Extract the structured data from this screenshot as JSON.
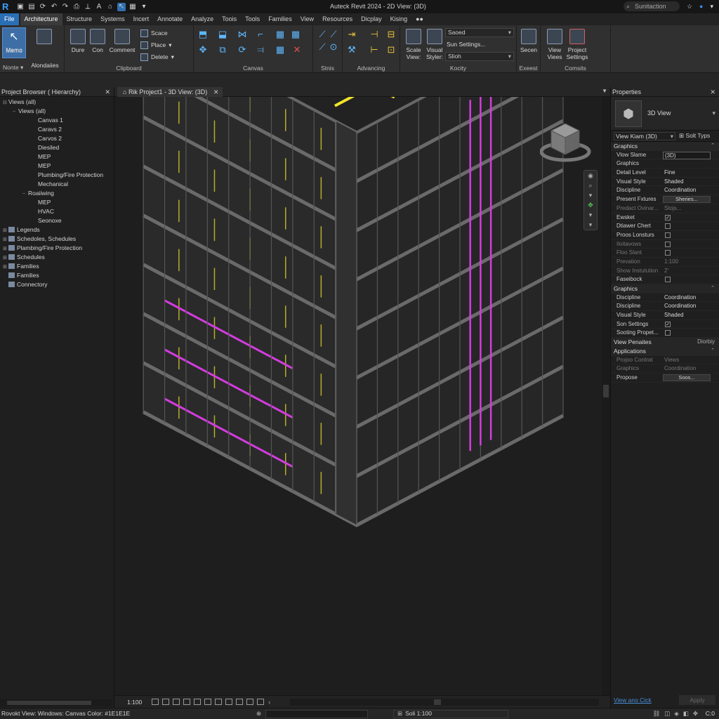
{
  "window": {
    "title": "Auteck Revit 2024 - 2D View: (3D)",
    "search_placeholder": "Sunitaction",
    "logo": "R"
  },
  "tabs": [
    "File",
    "Architecture",
    "Structure",
    "Systems",
    "Incert",
    "Annotate",
    "Analyze",
    "Toois",
    "Tools",
    "Families",
    "View",
    "Resources",
    "Dicplay",
    "Kising",
    "●●"
  ],
  "ribbon": {
    "modify": {
      "big1": "Memo",
      "big2": "Alondaiies",
      "label": "Nonte"
    },
    "clipboard": {
      "b1": "Dure",
      "b2": "Con",
      "b3": "Comment",
      "s1": "Scace",
      "s2": "Place",
      "s3": "Delete",
      "label": "Clipboard"
    },
    "canvas": {
      "label": "Canvas"
    },
    "stnis": {
      "label": "Stnis"
    },
    "advancing": {
      "label": "Advancing"
    },
    "kocity": {
      "b1": "Scale View:",
      "b2": "Visual Styler:",
      "dd1": "Saoed",
      "dd2": "Sun Settings...",
      "dd3": "Slioh",
      "label": "Kocity"
    },
    "exeest": {
      "b1": "Secen",
      "label": "Exeest"
    },
    "comsits": {
      "b1": "View Viees",
      "b2": "Project Settings",
      "label": "Comsits"
    }
  },
  "browser": {
    "title": "Project Browser ( Hierarchy)",
    "items": [
      {
        "label": "Views (all)",
        "level": 0,
        "tog": "⊟"
      },
      {
        "label": "Views (all)",
        "level": 1,
        "tog": "−"
      },
      {
        "label": "Canvas 1",
        "level": 3,
        "tog": ""
      },
      {
        "label": "Caravs 2",
        "level": 3,
        "tog": ""
      },
      {
        "label": "Carvos 2",
        "level": 3,
        "tog": ""
      },
      {
        "label": "Diesiled",
        "level": 3,
        "tog": ""
      },
      {
        "label": "MEP",
        "level": 3,
        "tog": ""
      },
      {
        "label": "MEP",
        "level": 3,
        "tog": ""
      },
      {
        "label": "Plumbing/Fire Protection",
        "level": 3,
        "tog": ""
      },
      {
        "label": "Mechanical",
        "level": 3,
        "tog": ""
      },
      {
        "label": "Roaiiwing",
        "level": 2,
        "tog": "−"
      },
      {
        "label": "MEP",
        "level": 3,
        "tog": ""
      },
      {
        "label": "HVAC",
        "level": 3,
        "tog": ""
      },
      {
        "label": "Seonoxe",
        "level": 3,
        "tog": ""
      },
      {
        "label": "Legends",
        "level": 0,
        "tog": "⊞",
        "icon": true
      },
      {
        "label": "Schedoles, Schedules",
        "level": 0,
        "tog": "⊞",
        "icon": true
      },
      {
        "label": "Plambing/Fire Protection",
        "level": 0,
        "tog": "⊞",
        "icon": true
      },
      {
        "label": "Schedules",
        "level": 0,
        "tog": "⊞",
        "icon": true
      },
      {
        "label": "Families",
        "level": 0,
        "tog": "⊞",
        "icon": true
      },
      {
        "label": "Families",
        "level": 0,
        "tog": "",
        "icon": true
      },
      {
        "label": "Connectory",
        "level": 0,
        "tog": "",
        "icon": true
      }
    ]
  },
  "view": {
    "tab_label": "Rik Project1 - 3D View: (3D)",
    "scale": "1:100",
    "colors": {
      "yellow": "#f2e52a",
      "cyan": "#27d3e8",
      "magenta": "#d43ce0",
      "structure": "#3c3c3c"
    }
  },
  "properties": {
    "title": "Properties",
    "type_name": "3D View",
    "view_name_field": "View Kiam (3D)",
    "edit_type": "Solt Typs",
    "groups": [
      {
        "header": "Graphics",
        "rows": [
          {
            "k": "Vlow Slame",
            "v": "(3D)",
            "kind": "input"
          },
          {
            "k": "Graphics",
            "v": "",
            "kind": "text"
          },
          {
            "k": "Detail Level",
            "v": "Fine",
            "kind": "text"
          },
          {
            "k": "Visual Style",
            "v": "Shaded",
            "kind": "text"
          },
          {
            "k": "Discipline",
            "v": "Coordination",
            "kind": "text"
          },
          {
            "k": "Present Fxtures",
            "v": "Sheries...",
            "kind": "button"
          },
          {
            "k": "Predact Ovinar...",
            "v": "Stojs...",
            "kind": "dimtext"
          },
          {
            "k": "Ewsket",
            "v": "✓",
            "kind": "check"
          },
          {
            "k": "Dtiawer Chert",
            "v": "",
            "kind": "check"
          },
          {
            "k": "Proos Lonsturs",
            "v": "",
            "kind": "check"
          },
          {
            "k": "Iloitavows",
            "v": "",
            "kind": "dimcheck"
          },
          {
            "k": "Floo Slant",
            "v": "",
            "kind": "dimcheck"
          },
          {
            "k": "Prevation",
            "v": "1:100",
            "kind": "dimtext"
          },
          {
            "k": "Show Instutution",
            "v": "2′",
            "kind": "dimtext"
          },
          {
            "k": "Faseibock",
            "v": "",
            "kind": "check"
          }
        ]
      },
      {
        "header": "Graphics",
        "rows": [
          {
            "k": "Discipline",
            "v": "Coordination",
            "kind": "text"
          },
          {
            "k": "Discipline",
            "v": "Coordination",
            "kind": "text"
          },
          {
            "k": "Visual Style",
            "v": "Shaded",
            "kind": "text"
          },
          {
            "k": "Son Settings",
            "v": "✓",
            "kind": "check"
          },
          {
            "k": "Sooting Propet...",
            "v": "",
            "kind": "check"
          }
        ]
      },
      {
        "header": "View Penaites",
        "side": "Diorbiy",
        "rows": []
      },
      {
        "header": "Applications",
        "rows": [
          {
            "k": "Projoo Contrat",
            "v": "Views",
            "kind": "dimtext"
          },
          {
            "k": "Graphics",
            "v": "Coordination",
            "kind": "dimtext"
          },
          {
            "k": "Propose",
            "v": "Soos...",
            "kind": "button"
          }
        ]
      }
    ],
    "help_link": "View ano Cick",
    "apply": "Apply"
  },
  "status": {
    "message": "Rovokt View: Windows: Canvas Color: #1E1E1E",
    "scale": "Soli 1:100",
    "count": "C:0"
  }
}
